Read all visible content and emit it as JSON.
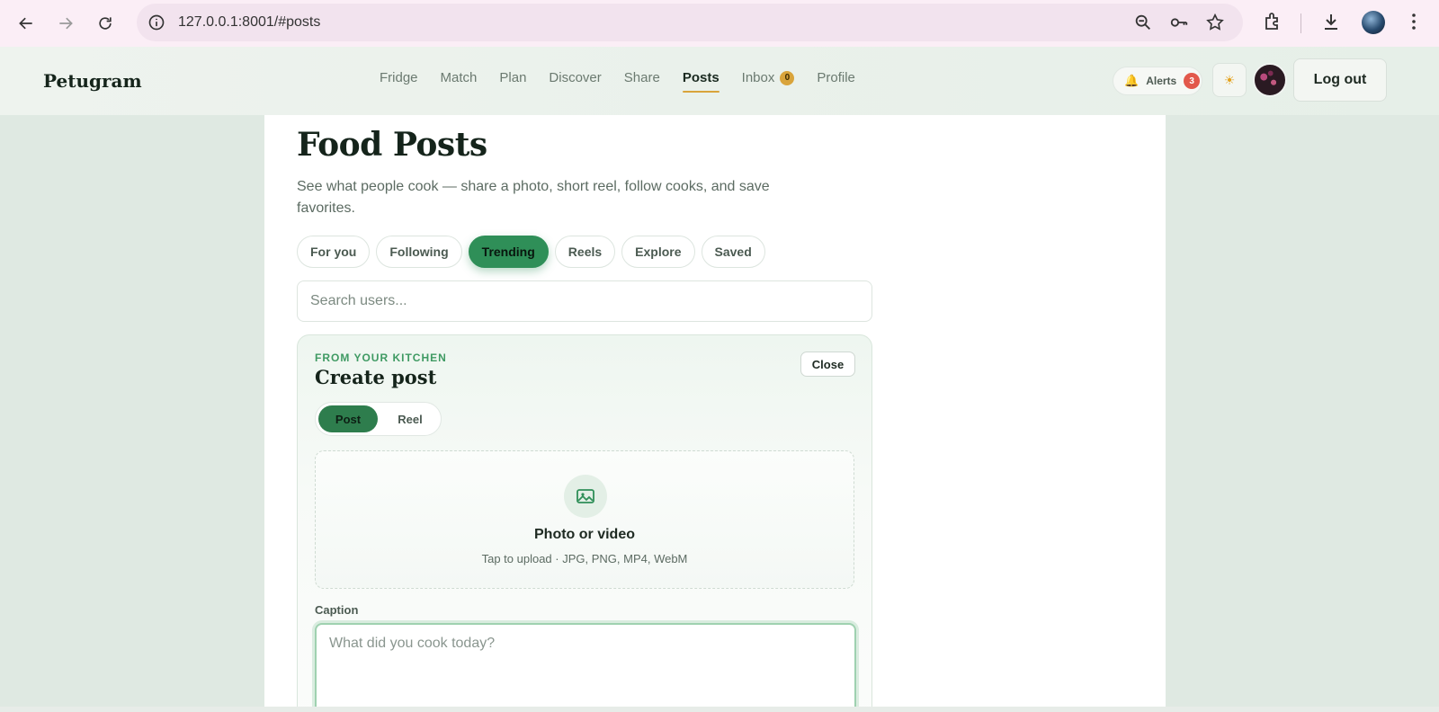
{
  "browser": {
    "url": "127.0.0.1:8001/#posts"
  },
  "header": {
    "logo": "Petugram",
    "nav": [
      {
        "label": "Fridge"
      },
      {
        "label": "Match"
      },
      {
        "label": "Plan"
      },
      {
        "label": "Discover"
      },
      {
        "label": "Share"
      },
      {
        "label": "Posts"
      },
      {
        "label": "Inbox",
        "badge": "0"
      },
      {
        "label": "Profile"
      }
    ],
    "active_nav": "Posts",
    "alerts_label": "Alerts",
    "alerts_count": "3",
    "theme_icon": "☀",
    "logout_label": "Log out"
  },
  "main": {
    "title": "Food Posts",
    "subtitle": "See what people cook — share a photo, short reel, follow cooks, and save favorites.",
    "tabs": [
      {
        "label": "For you"
      },
      {
        "label": "Following"
      },
      {
        "label": "Trending"
      },
      {
        "label": "Reels"
      },
      {
        "label": "Explore"
      },
      {
        "label": "Saved"
      }
    ],
    "active_tab": "Trending",
    "search_placeholder": "Search users..."
  },
  "create_post": {
    "eyebrow": "FROM YOUR KITCHEN",
    "title": "Create post",
    "close_label": "Close",
    "mode_post": "Post",
    "mode_reel": "Reel",
    "upload_title": "Photo or video",
    "upload_sub": "Tap to upload · JPG, PNG, MP4, WebM",
    "caption_label": "Caption",
    "caption_placeholder": "What did you cook today?"
  },
  "colors": {
    "accent": "#2f8f58",
    "nav_underline": "#d9a43b",
    "alert_badge": "#e2584b"
  }
}
